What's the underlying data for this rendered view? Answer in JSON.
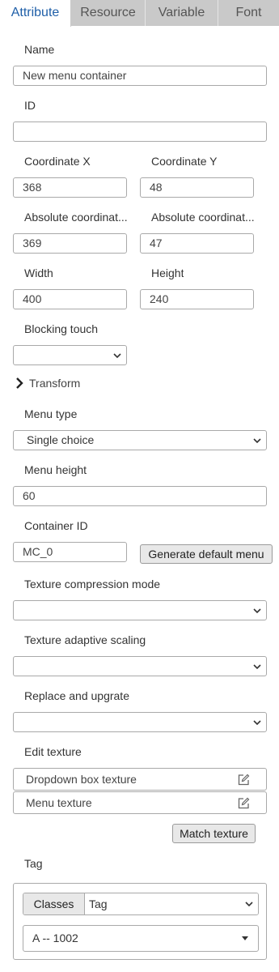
{
  "tabs": [
    "Attribute",
    "Resource",
    "Variable",
    "Font"
  ],
  "fields": {
    "name": {
      "label": "Name",
      "value": "New menu container"
    },
    "id": {
      "label": "ID",
      "value": ""
    },
    "coord_x": {
      "label": "Coordinate X",
      "value": "368"
    },
    "coord_y": {
      "label": "Coordinate Y",
      "value": "48"
    },
    "abs_x": {
      "label": "Absolute coordinat...",
      "value": "369"
    },
    "abs_y": {
      "label": "Absolute coordinat...",
      "value": "47"
    },
    "width": {
      "label": "Width",
      "value": "400"
    },
    "height": {
      "label": "Height",
      "value": "240"
    },
    "blocking_touch": {
      "label": "Blocking touch",
      "value": ""
    },
    "transform": {
      "label": "Transform"
    },
    "menu_type": {
      "label": "Menu type",
      "value": "Single choice"
    },
    "menu_height": {
      "label": "Menu height",
      "value": "60"
    },
    "container_id": {
      "label": "Container ID",
      "value": "MC_0"
    },
    "texture_compression": {
      "label": "Texture compression mode",
      "value": ""
    },
    "texture_scaling": {
      "label": "Texture adaptive scaling",
      "value": ""
    },
    "replace_upgrade": {
      "label": "Replace and upgrate",
      "value": ""
    },
    "edit_texture": {
      "label": "Edit texture"
    },
    "tag": {
      "label": "Tag"
    }
  },
  "buttons": {
    "generate_default_menu": "Generate default menu",
    "match_texture": "Match texture",
    "classes": "Classes"
  },
  "textures": [
    "Dropdown box texture",
    "Menu texture"
  ],
  "tag_box": {
    "select_value": "Tag",
    "dropdown_value": "A -- 1002"
  },
  "colors": {
    "active_tab_text": "#1f5fa8",
    "inactive_tab_bg": "#c9c9c9"
  },
  "icons": {
    "transform": "chevron-right-icon",
    "select": "chevron-down-icon",
    "edit": "edit-icon",
    "dropdown": "caret-down-icon"
  }
}
